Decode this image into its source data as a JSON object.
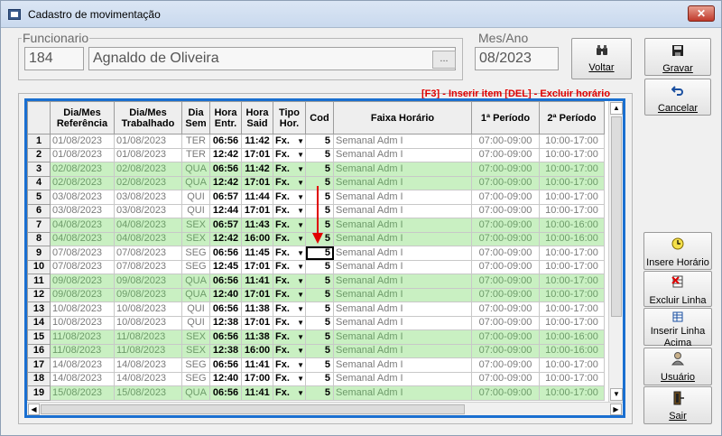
{
  "window": {
    "title": "Cadastro de movimentação",
    "close_label": "✕"
  },
  "funcionario": {
    "label": "Funcionario",
    "code": "184",
    "name": "Agnaldo de Oliveira",
    "lookup_label": "..."
  },
  "mes_ano": {
    "label": "Mes/Ano",
    "value": "08/2023"
  },
  "buttons": {
    "voltar": "Voltar",
    "gravar": "Gravar",
    "cancelar": "Cancelar",
    "insere_horario": "Insere Horário",
    "excluir_linha": "Excluir Linha",
    "inserir_linha_acima_1": "Inserir Linha",
    "inserir_linha_acima_2": "Acima",
    "usuario": "Usuário",
    "sair": "Sair"
  },
  "grid_hint": "[F3] - Inserir item [DEL] - Excluir horário",
  "grid": {
    "headers": [
      "",
      "Dia/Mes\nReferência",
      "Dia/Mes\nTrabalhado",
      "Dia\nSem",
      "Hora\nEntr.",
      "Hora\nSaid",
      "Tipo\nHor.",
      "Cod",
      "Faixa Horário",
      "1ª Período",
      "2ª Período"
    ],
    "rows": [
      {
        "n": "1",
        "ref": "01/08/2023",
        "trab": "01/08/2023",
        "dia": "TER",
        "entr": "06:56",
        "said": "11:42",
        "tipo": "Fx.",
        "cod": "5",
        "faixa": "Semanal Adm I",
        "p1": "07:00-09:00",
        "p2": "10:00-17:00",
        "green": false
      },
      {
        "n": "2",
        "ref": "01/08/2023",
        "trab": "01/08/2023",
        "dia": "TER",
        "entr": "12:42",
        "said": "17:01",
        "tipo": "Fx.",
        "cod": "5",
        "faixa": "Semanal Adm I",
        "p1": "07:00-09:00",
        "p2": "10:00-17:00",
        "green": false
      },
      {
        "n": "3",
        "ref": "02/08/2023",
        "trab": "02/08/2023",
        "dia": "QUA",
        "entr": "06:56",
        "said": "11:42",
        "tipo": "Fx.",
        "cod": "5",
        "faixa": "Semanal Adm I",
        "p1": "07:00-09:00",
        "p2": "10:00-17:00",
        "green": true
      },
      {
        "n": "4",
        "ref": "02/08/2023",
        "trab": "02/08/2023",
        "dia": "QUA",
        "entr": "12:42",
        "said": "17:01",
        "tipo": "Fx.",
        "cod": "5",
        "faixa": "Semanal Adm I",
        "p1": "07:00-09:00",
        "p2": "10:00-17:00",
        "green": true
      },
      {
        "n": "5",
        "ref": "03/08/2023",
        "trab": "03/08/2023",
        "dia": "QUI",
        "entr": "06:57",
        "said": "11:44",
        "tipo": "Fx.",
        "cod": "5",
        "faixa": "Semanal Adm I",
        "p1": "07:00-09:00",
        "p2": "10:00-17:00",
        "green": false
      },
      {
        "n": "6",
        "ref": "03/08/2023",
        "trab": "03/08/2023",
        "dia": "QUI",
        "entr": "12:44",
        "said": "17:01",
        "tipo": "Fx.",
        "cod": "5",
        "faixa": "Semanal Adm I",
        "p1": "07:00-09:00",
        "p2": "10:00-17:00",
        "green": false
      },
      {
        "n": "7",
        "ref": "04/08/2023",
        "trab": "04/08/2023",
        "dia": "SEX",
        "entr": "06:57",
        "said": "11:43",
        "tipo": "Fx.",
        "cod": "5",
        "faixa": "Semanal Adm I",
        "p1": "07:00-09:00",
        "p2": "10:00-16:00",
        "green": true
      },
      {
        "n": "8",
        "ref": "04/08/2023",
        "trab": "04/08/2023",
        "dia": "SEX",
        "entr": "12:42",
        "said": "16:00",
        "tipo": "Fx.",
        "cod": "5",
        "faixa": "Semanal Adm I",
        "p1": "07:00-09:00",
        "p2": "10:00-16:00",
        "green": true
      },
      {
        "n": "9",
        "ref": "07/08/2023",
        "trab": "07/08/2023",
        "dia": "SEG",
        "entr": "06:56",
        "said": "11:45",
        "tipo": "Fx.",
        "cod": "5",
        "faixa": "Semanal Adm I",
        "p1": "07:00-09:00",
        "p2": "10:00-17:00",
        "green": false,
        "selected": true
      },
      {
        "n": "10",
        "ref": "07/08/2023",
        "trab": "07/08/2023",
        "dia": "SEG",
        "entr": "12:45",
        "said": "17:01",
        "tipo": "Fx.",
        "cod": "5",
        "faixa": "Semanal Adm I",
        "p1": "07:00-09:00",
        "p2": "10:00-17:00",
        "green": false
      },
      {
        "n": "11",
        "ref": "09/08/2023",
        "trab": "09/08/2023",
        "dia": "QUA",
        "entr": "06:56",
        "said": "11:41",
        "tipo": "Fx.",
        "cod": "5",
        "faixa": "Semanal Adm I",
        "p1": "07:00-09:00",
        "p2": "10:00-17:00",
        "green": true
      },
      {
        "n": "12",
        "ref": "09/08/2023",
        "trab": "09/08/2023",
        "dia": "QUA",
        "entr": "12:40",
        "said": "17:01",
        "tipo": "Fx.",
        "cod": "5",
        "faixa": "Semanal Adm I",
        "p1": "07:00-09:00",
        "p2": "10:00-17:00",
        "green": true
      },
      {
        "n": "13",
        "ref": "10/08/2023",
        "trab": "10/08/2023",
        "dia": "QUI",
        "entr": "06:56",
        "said": "11:38",
        "tipo": "Fx.",
        "cod": "5",
        "faixa": "Semanal Adm I",
        "p1": "07:00-09:00",
        "p2": "10:00-17:00",
        "green": false
      },
      {
        "n": "14",
        "ref": "10/08/2023",
        "trab": "10/08/2023",
        "dia": "QUI",
        "entr": "12:38",
        "said": "17:01",
        "tipo": "Fx.",
        "cod": "5",
        "faixa": "Semanal Adm I",
        "p1": "07:00-09:00",
        "p2": "10:00-17:00",
        "green": false
      },
      {
        "n": "15",
        "ref": "11/08/2023",
        "trab": "11/08/2023",
        "dia": "SEX",
        "entr": "06:56",
        "said": "11:38",
        "tipo": "Fx.",
        "cod": "5",
        "faixa": "Semanal Adm I",
        "p1": "07:00-09:00",
        "p2": "10:00-16:00",
        "green": true
      },
      {
        "n": "16",
        "ref": "11/08/2023",
        "trab": "11/08/2023",
        "dia": "SEX",
        "entr": "12:38",
        "said": "16:00",
        "tipo": "Fx.",
        "cod": "5",
        "faixa": "Semanal Adm I",
        "p1": "07:00-09:00",
        "p2": "10:00-16:00",
        "green": true
      },
      {
        "n": "17",
        "ref": "14/08/2023",
        "trab": "14/08/2023",
        "dia": "SEG",
        "entr": "06:56",
        "said": "11:41",
        "tipo": "Fx.",
        "cod": "5",
        "faixa": "Semanal Adm I",
        "p1": "07:00-09:00",
        "p2": "10:00-17:00",
        "green": false
      },
      {
        "n": "18",
        "ref": "14/08/2023",
        "trab": "14/08/2023",
        "dia": "SEG",
        "entr": "12:40",
        "said": "17:00",
        "tipo": "Fx.",
        "cod": "5",
        "faixa": "Semanal Adm I",
        "p1": "07:00-09:00",
        "p2": "10:00-17:00",
        "green": false
      },
      {
        "n": "19",
        "ref": "15/08/2023",
        "trab": "15/08/2023",
        "dia": "QUA",
        "entr": "06:56",
        "said": "11:41",
        "tipo": "Fx.",
        "cod": "5",
        "faixa": "Semanal Adm I",
        "p1": "07:00-09:00",
        "p2": "10:00-17:00",
        "green": true
      }
    ]
  },
  "colors": {
    "row_green": "#c9f0c2",
    "grid_border": "#1a6fd0",
    "hint_red": "#e00000",
    "annotation_arrow": "#e00000"
  },
  "icons": {
    "voltar": "binoculars-icon",
    "gravar": "floppy-disk-icon",
    "cancelar": "undo-arrow-icon",
    "insere_horario": "clock-icon",
    "excluir_linha": "delete-row-icon",
    "inserir_linha_acima": "insert-row-icon",
    "usuario": "user-icon",
    "sair": "exit-door-icon"
  }
}
